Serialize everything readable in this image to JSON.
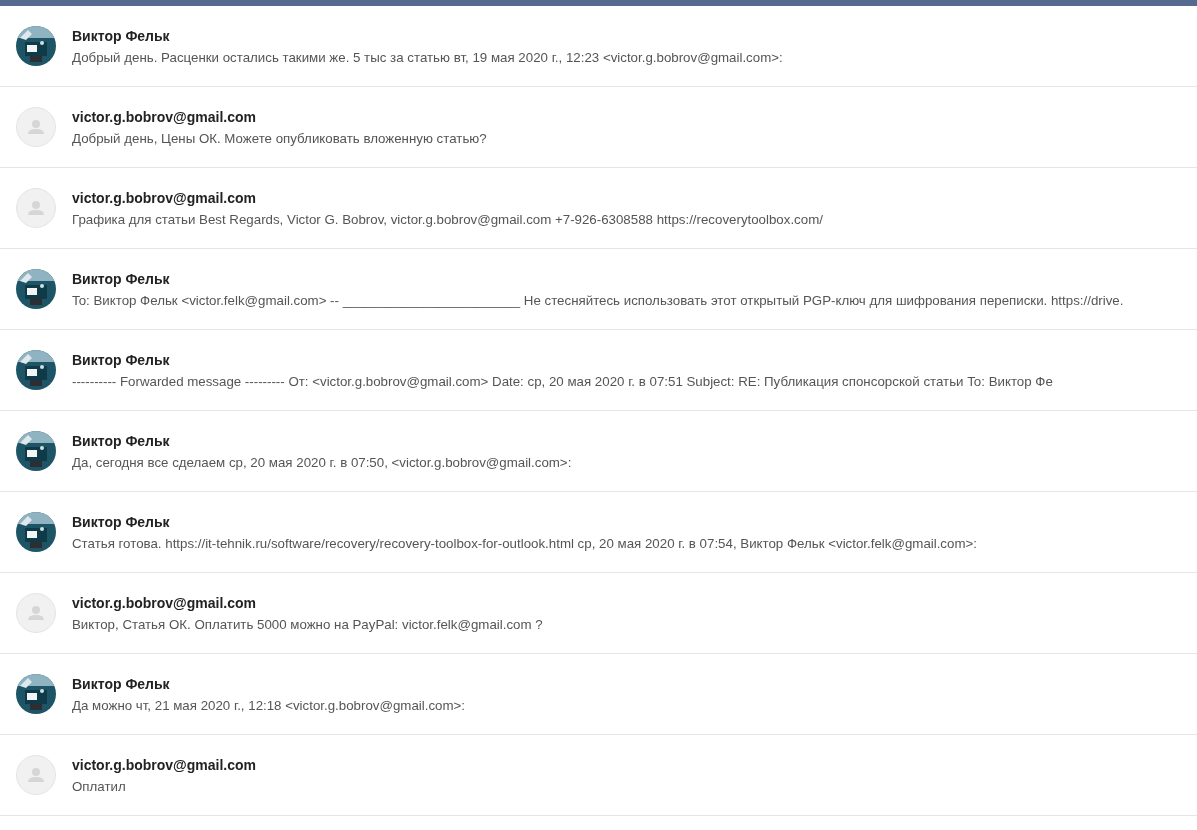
{
  "messages": [
    {
      "sender": "Виктор Фельк",
      "preview": "Добрый день. Расценки остались такими же. 5 тыс за статью вт, 19 мая 2020 г., 12:23 <victor.g.bobrov@gmail.com>:"
    },
    {
      "sender": "victor.g.bobrov@gmail.com",
      "kind": "default",
      "preview": "Добрый день, Цены ОК. Можете опубликовать вложенную статью?"
    },
    {
      "sender": "victor.g.bobrov@gmail.com",
      "kind": "default",
      "preview": "Графика для статьи Best Regards, Victor G. Bobrov, victor.g.bobrov@gmail.com +7-926-6308588 https://recoverytoolbox.com/"
    },
    {
      "sender": "Виктор Фельк",
      "preview": "To: Виктор Фельк <victor.felk@gmail.com> -- ________________________ Не стесняйтесь использовать этот открытый PGP-ключ для шифрования переписки. https://drive."
    },
    {
      "sender": "Виктор Фельк",
      "preview": "---------- Forwarded message --------- От: <victor.g.bobrov@gmail.com> Date: ср, 20 мая 2020 г. в 07:51 Subject: RE: Публикация спонсорской статьи To: Виктор Фе"
    },
    {
      "sender": "Виктор Фельк",
      "preview": "Да, сегодня все сделаем ср, 20 мая 2020 г. в 07:50, <victor.g.bobrov@gmail.com>:"
    },
    {
      "sender": "Виктор Фельк",
      "preview": "Статья готова. https://it-tehnik.ru/software/recovery/recovery-toolbox-for-outlook.html ср, 20 мая 2020 г. в 07:54, Виктор Фельк <victor.felk@gmail.com>:"
    },
    {
      "sender": "victor.g.bobrov@gmail.com",
      "kind": "default",
      "preview": "Виктор, Статья ОК. Оплатить 5000 можно на PayPal: victor.felk@gmail.com ?"
    },
    {
      "sender": "Виктор Фельк",
      "preview": "Да можно чт, 21 мая 2020 г., 12:18 <victor.g.bobrov@gmail.com>:"
    },
    {
      "sender": "victor.g.bobrov@gmail.com",
      "kind": "default",
      "preview": "Оплатил"
    }
  ]
}
